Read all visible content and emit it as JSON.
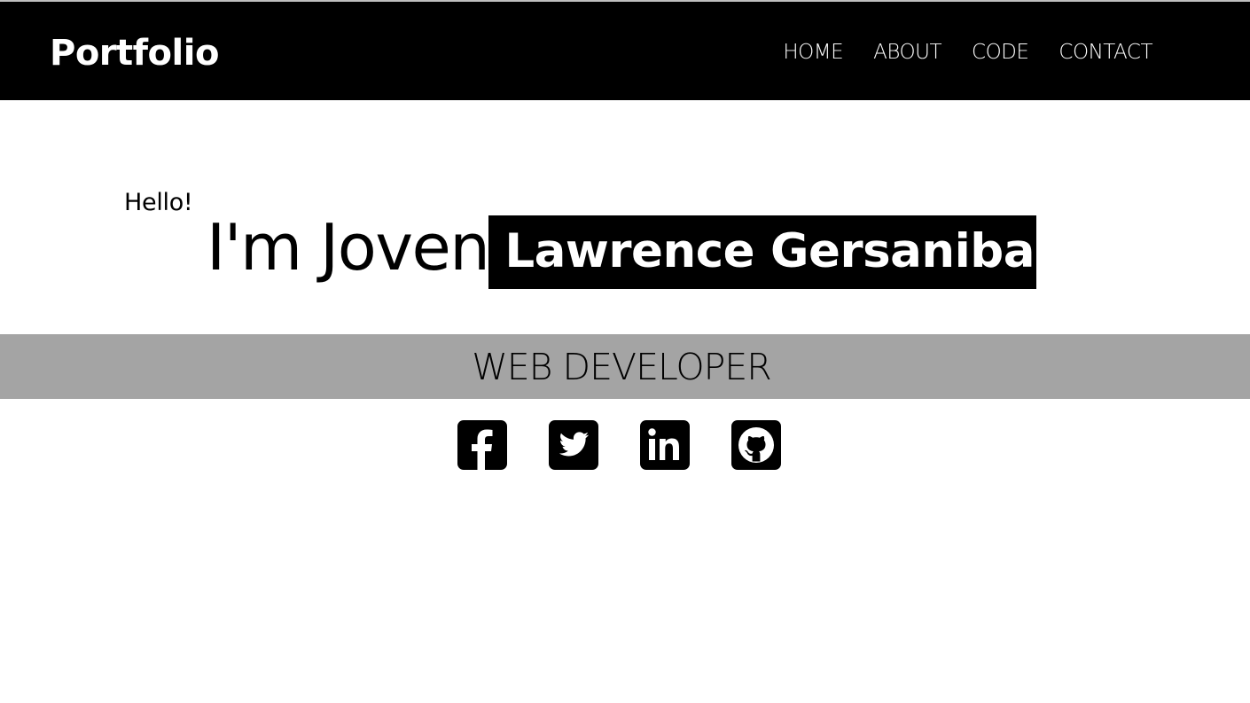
{
  "navbar": {
    "brand": "Portfolio",
    "links": [
      {
        "label": "HOME"
      },
      {
        "label": "ABOUT"
      },
      {
        "label": "CODE"
      },
      {
        "label": "CONTACT"
      }
    ]
  },
  "hero": {
    "greeting": "Hello!",
    "intro": "I'm Joven",
    "highlight_name": "Lawrence Gersaniba",
    "role": "WEB DEVELOPER"
  },
  "socials": [
    {
      "icon": "facebook-icon"
    },
    {
      "icon": "twitter-icon"
    },
    {
      "icon": "linkedin-icon"
    },
    {
      "icon": "github-icon"
    }
  ],
  "colors": {
    "navbar_bg": "#000000",
    "role_band_bg": "#a4a4a4",
    "highlight_bg": "#000000",
    "page_bg": "#ffffff"
  }
}
